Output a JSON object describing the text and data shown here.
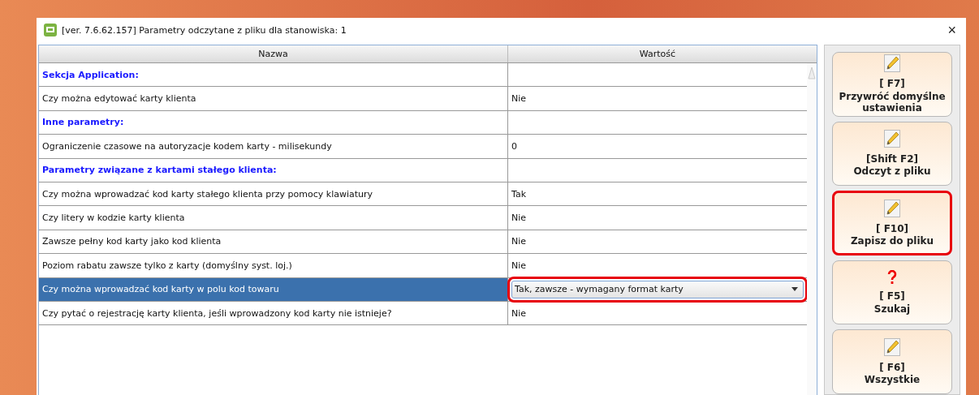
{
  "window": {
    "title": "[ver. 7.6.62.157] Parametry odczytane z pliku dla stanowiska: 1",
    "close": "×"
  },
  "table": {
    "columns": [
      "Nazwa",
      "Wartość"
    ],
    "rows": [
      {
        "kind": "section",
        "name": "Sekcja Application:",
        "selected": false
      },
      {
        "kind": "param",
        "name": "Czy można edytować karty klienta",
        "value": "Nie",
        "selected": false
      },
      {
        "kind": "section",
        "name": "Inne parametry:",
        "selected": false
      },
      {
        "kind": "param",
        "name": "Ograniczenie czasowe na autoryzacje kodem karty - milisekundy",
        "value": "0",
        "selected": false
      },
      {
        "kind": "section",
        "name": "Parametry związane z kartami stałego klienta:",
        "selected": false
      },
      {
        "kind": "param",
        "name": "Czy można wprowadzać kod karty stałego klienta przy pomocy klawiatury",
        "value": "Tak",
        "selected": false
      },
      {
        "kind": "param",
        "name": "Czy litery w kodzie karty klienta",
        "value": "Nie",
        "selected": false
      },
      {
        "kind": "param",
        "name": "Zawsze pełny kod karty jako kod klienta",
        "value": "Nie",
        "selected": false
      },
      {
        "kind": "param",
        "name": "Poziom rabatu zawsze tylko z karty (domyślny syst. loj.)",
        "value": "Nie",
        "selected": false
      },
      {
        "kind": "dropdown",
        "name": "Czy można wprowadzać kod karty w polu kod towaru",
        "value": "Tak, zawsze - wymagany format karty",
        "selected": true,
        "highlighted": true
      },
      {
        "kind": "param",
        "name": "Czy pytać o rejestrację karty klienta, jeśli wprowadzony kod karty nie istnieje?",
        "value": "Nie",
        "selected": false
      }
    ]
  },
  "buttons": [
    {
      "kind": "edit",
      "key": "[ F7]",
      "label": "Przywróć domyślne ustawienia",
      "highlighted": false
    },
    {
      "kind": "edit",
      "key": "[Shift F2]",
      "label": "Odczyt z pliku",
      "highlighted": false
    },
    {
      "kind": "edit",
      "key": "[ F10]",
      "label": "Zapisz do pliku",
      "highlighted": true
    },
    {
      "kind": "search",
      "key": "[ F5]",
      "label": "Szukaj",
      "highlighted": false
    },
    {
      "kind": "edit",
      "key": "[ F6]",
      "label": "Wszystkie",
      "highlighted": false
    }
  ]
}
